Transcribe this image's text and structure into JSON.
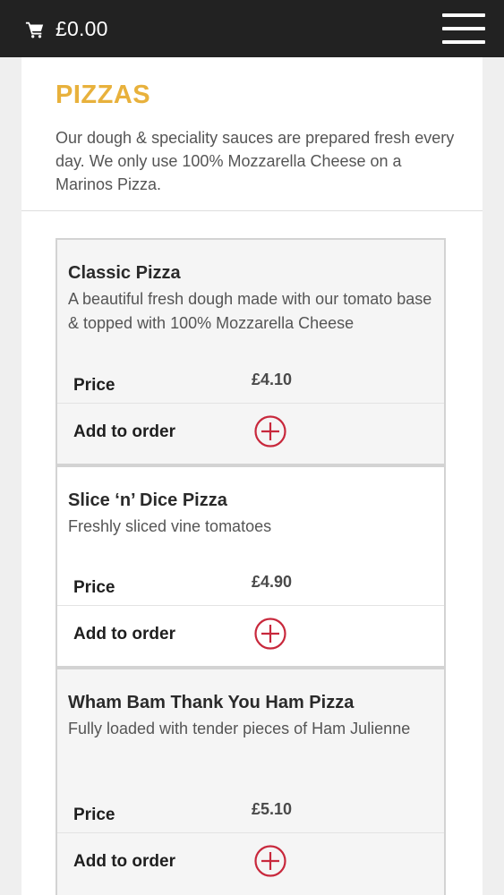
{
  "topbar": {
    "cart_icon": "shopping-cart-icon",
    "cart_total": "£0.00",
    "menu_icon": "hamburger-menu-icon"
  },
  "header": {
    "title": "PIZZAS",
    "intro": "Our dough & speciality sauces are prepared fresh every day. We only use 100% Mozzarella Cheese on a Marinos Pizza."
  },
  "labels": {
    "price": "Price",
    "add_to_order": "Add to order"
  },
  "products": [
    {
      "name": "Classic Pizza",
      "description": "A beautiful fresh dough made with our tomato base & topped with 100% Mozzarella Cheese",
      "price": "£4.10"
    },
    {
      "name": "Slice ‘n’ Dice Pizza",
      "description": "Freshly sliced vine tomatoes",
      "price": "£4.90"
    },
    {
      "name": "Wham Bam Thank You Ham Pizza",
      "description": "Fully loaded with tender pieces of Ham Julienne",
      "price": "£5.10"
    }
  ],
  "colors": {
    "topbar_bg": "#222222",
    "title_accent": "#e8b13c",
    "add_icon": "#c8283c"
  }
}
